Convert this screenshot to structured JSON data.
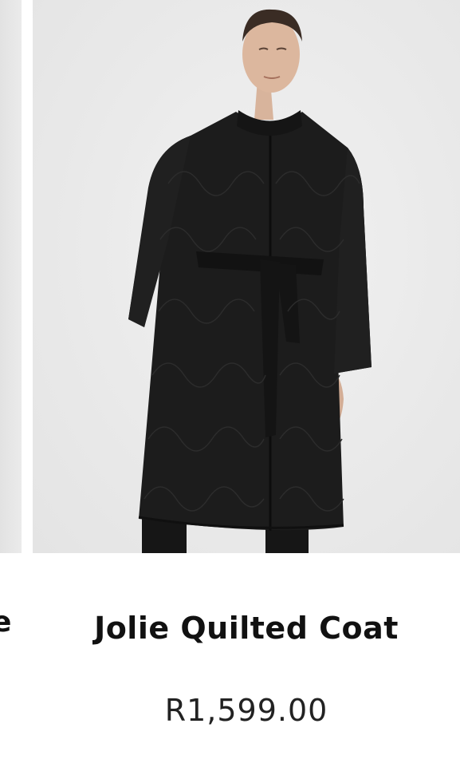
{
  "carousel": {
    "previous_item": {
      "title_fragment": "e"
    },
    "current_item": {
      "title": "Jolie Quilted Coat",
      "price": "R1,599.00",
      "image_alt": "Jolie Quilted Coat",
      "image_background_color": "#ececec",
      "garment_color": "#1b1b1b"
    }
  }
}
